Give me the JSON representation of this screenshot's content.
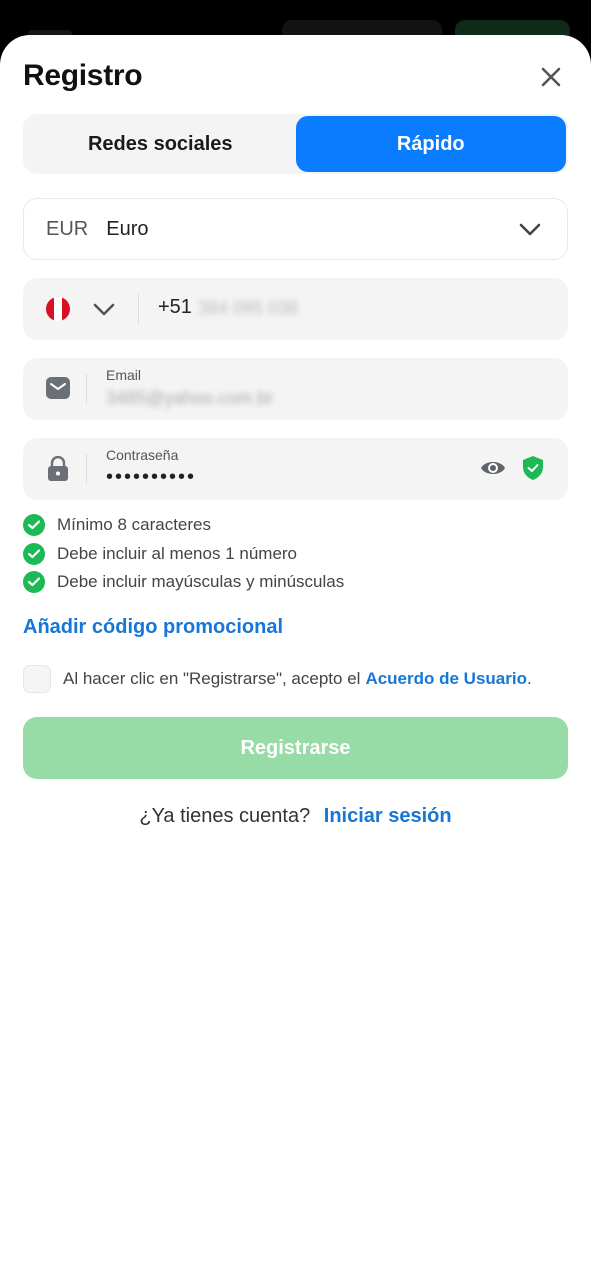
{
  "header": {
    "title": "Registro"
  },
  "tabs": [
    {
      "label": "Redes sociales",
      "active": false
    },
    {
      "label": "Rápido",
      "active": true
    }
  ],
  "currency": {
    "code": "EUR",
    "name": "Euro"
  },
  "phone": {
    "prefix": "+51",
    "number": "384 095 038"
  },
  "email": {
    "label": "Email",
    "value": "3485@yahoo.com.br"
  },
  "password": {
    "label": "Contraseña",
    "value": "••••••••••"
  },
  "rules": [
    "Mínimo 8 caracteres",
    "Debe incluir al menos 1 número",
    "Debe incluir mayúsculas y minúsculas"
  ],
  "promo": {
    "label": "Añadir código promocional"
  },
  "agreement": {
    "text": "Al hacer clic en \"Registrarse\", acepto el",
    "link": "Acuerdo de Usuario",
    "suffix": "."
  },
  "submit": {
    "label": "Registrarse"
  },
  "login": {
    "question": "¿Ya tienes cuenta?",
    "link": "Iniciar sesión"
  },
  "colors": {
    "accent": "#0a7cff",
    "link": "#1577d6",
    "success": "#1db954",
    "submit_disabled": "#97dba6"
  }
}
